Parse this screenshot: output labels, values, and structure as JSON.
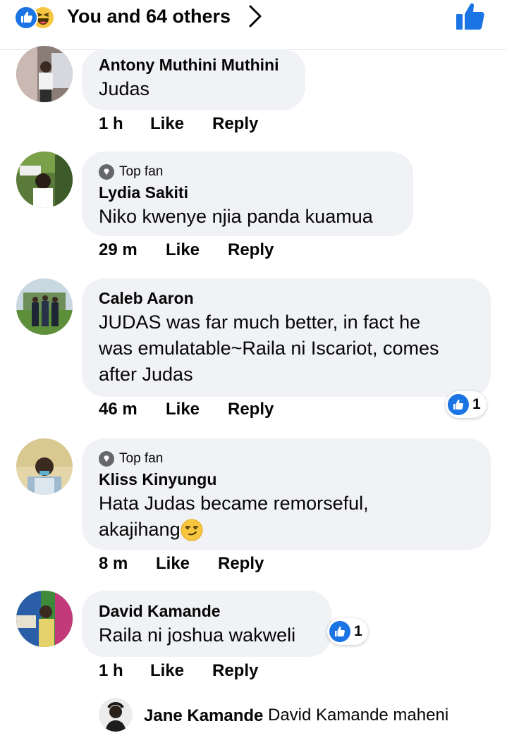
{
  "header": {
    "reactions_text": "You and 64 others",
    "reaction_icons": [
      "like-icon",
      "haha-icon"
    ],
    "accent": "#1b74e4"
  },
  "comments": [
    {
      "author": "Antony Muthini Muthini",
      "top_fan": false,
      "lines": [
        "Judas"
      ],
      "time": "1 h",
      "like_label": "Like",
      "reply_label": "Reply",
      "likes": null
    },
    {
      "author": "Lydia Sakiti",
      "top_fan": true,
      "top_fan_label": "Top fan",
      "lines": [
        "Niko kwenye njia panda kuamua"
      ],
      "time": "29 m",
      "like_label": "Like",
      "reply_label": "Reply",
      "likes": null
    },
    {
      "author": "Caleb Aaron",
      "top_fan": false,
      "lines": [
        "JUDAS was far much better, in fact he",
        "was emulatable~Raila ni Iscariot, comes",
        "after Judas"
      ],
      "time": "46 m",
      "like_label": "Like",
      "reply_label": "Reply",
      "likes": "1"
    },
    {
      "author": "Kliss Kinyungu",
      "top_fan": true,
      "top_fan_label": "Top fan",
      "lines": [
        "Hata Judas became remorseful,",
        "akajihang"
      ],
      "emoji": "smirk-emoji",
      "time": "8 m",
      "like_label": "Like",
      "reply_label": "Reply",
      "likes": null
    },
    {
      "author": "David Kamande",
      "top_fan": false,
      "lines": [
        "Raila ni joshua wakweli"
      ],
      "time": "1 h",
      "like_label": "Like",
      "reply_label": "Reply",
      "likes": "1"
    }
  ],
  "reply_preview": {
    "author": "Jane Kamande",
    "text": "David Kamande maheni"
  }
}
